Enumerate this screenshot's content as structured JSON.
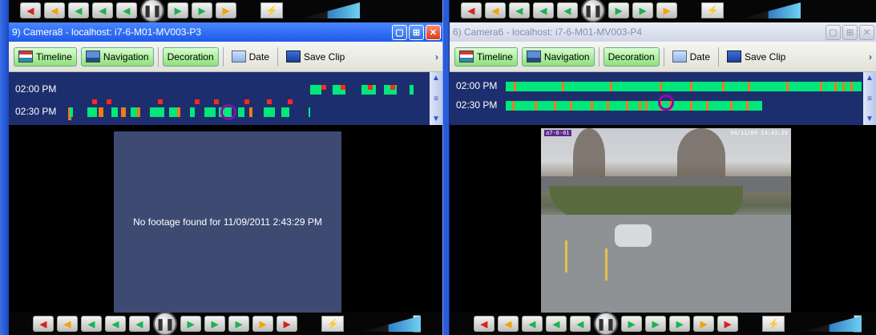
{
  "panes": [
    {
      "id": "left",
      "title": "9) Camera8 - localhost: i7-6-M01-MV003-P3",
      "active": true,
      "toolbar": {
        "timeline_label": "Timeline",
        "navigation_label": "Navigation",
        "decoration_label": "Decoration",
        "date_label": "Date",
        "save_clip_label": "Save Clip"
      },
      "timeline": {
        "rows": [
          {
            "label": "02:00 PM"
          },
          {
            "label": "02:30 PM"
          }
        ]
      },
      "video": {
        "message": "No footage found for 11/09/2011 2:43:29 PM"
      }
    },
    {
      "id": "right",
      "title": "6) Camera6 - localhost: i7-6-M01-MV003-P4",
      "active": false,
      "toolbar": {
        "timeline_label": "Timeline",
        "navigation_label": "Navigation",
        "decoration_label": "Decoration",
        "date_label": "Date",
        "save_clip_label": "Save Clip"
      },
      "timeline": {
        "rows": [
          {
            "label": "02:00 PM"
          },
          {
            "label": "02:30 PM"
          }
        ]
      },
      "video": {
        "stamp_left": "a7-6-01",
        "stamp_right": "04/11/09 14:43:29"
      }
    }
  ],
  "icons": [
    "timeline-icon",
    "navigation-icon",
    "date-icon",
    "save-icon",
    "pause-icon",
    "volume-icon"
  ],
  "colors": {
    "motion": "#00e87a",
    "recording": "#f07a18",
    "event": "#ff2a1a",
    "marker": "#8a0ea8",
    "timeline_bg": "#1d2e6e",
    "active_title": "#1d5bea"
  }
}
